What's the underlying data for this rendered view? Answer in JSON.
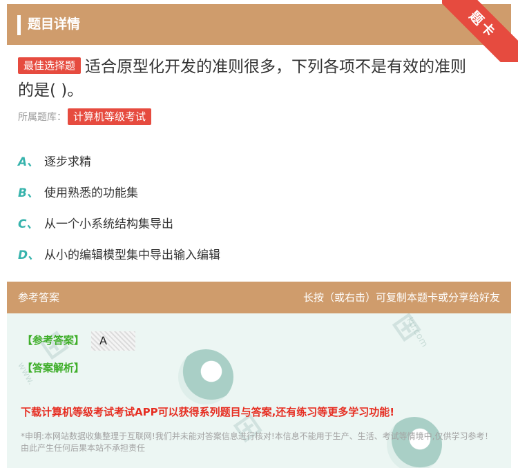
{
  "header": {
    "title": "题目详情",
    "ribbon": "题卡"
  },
  "question": {
    "type_tag": "最佳选择题",
    "text_line1": "适合原型化开发的准则很多，下列各项不是有效的准则",
    "text_line2": "的是( )。",
    "source_label": "所属题库：",
    "source_tag": "计算机等级考试"
  },
  "options": [
    {
      "letter": "A、",
      "text": "逐步求精"
    },
    {
      "letter": "B、",
      "text": "使用熟悉的功能集"
    },
    {
      "letter": "C、",
      "text": "从一个小系统结构集导出"
    },
    {
      "letter": "D、",
      "text": "从小的编辑模型集中导出输入编辑"
    }
  ],
  "answer": {
    "head_left": "参考答案",
    "head_right": "长按（或右击）可复制本题卡或分享给好友",
    "ref_label": "【参考答案】",
    "ref_value": "A",
    "analysis_label": "【答案解析】",
    "promo": "下载计算机等级考试考试APP可以获得系列题目与答案,还有练习等更多学习功能!",
    "disclaimer": "*申明:本网站数据收集整理于互联网!我们并未能对答案信息进行核对!本信息不能用于生产、生活、考试等情境中,仅供学习参考！由此产生任何后果本站不承担责任"
  },
  "colors": {
    "header_bg": "#cf9c6c",
    "tag_red": "#e64b3f",
    "option_letter": "#36b3ac",
    "answer_green": "#3fae2a",
    "promo_red": "#e62e22"
  }
}
